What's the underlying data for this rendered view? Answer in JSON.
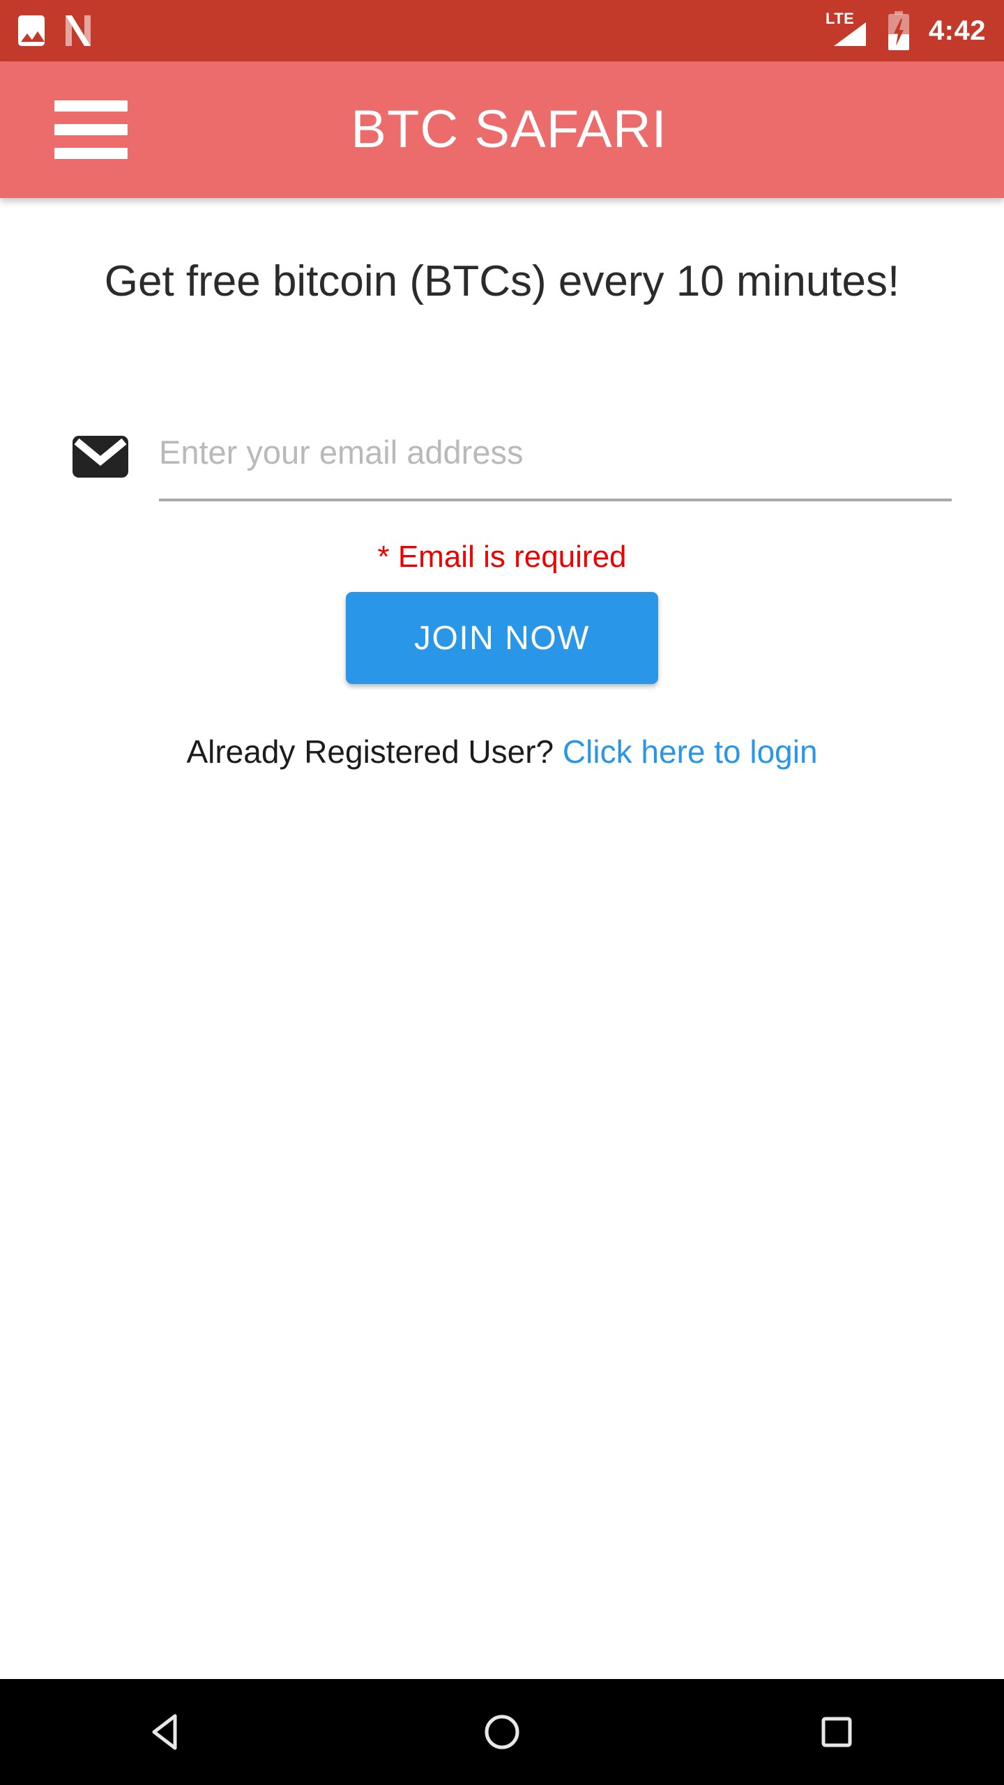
{
  "status_bar": {
    "background_color": "#C43A2A",
    "time": "4:42",
    "network_label": "LTE",
    "icons": [
      "photo-icon",
      "netflix-n-icon",
      "lte-signal-icon",
      "battery-charging-icon"
    ],
    "battery_level_percent": 40
  },
  "app_bar": {
    "background_color": "#EC6B6B",
    "title": "BTC SAFARI",
    "menu_icon": "hamburger-menu-icon"
  },
  "main": {
    "headline": "Get free bitcoin (BTCs) every 10 minutes!",
    "email": {
      "icon": "email-envelope-icon",
      "placeholder": "Enter your email address",
      "value": ""
    },
    "error_message": "* Email is required",
    "error_color": "#EE0000",
    "join_button": {
      "label": "JOIN NOW",
      "color": "#2A96E8"
    },
    "login_prompt": "Already Registered User? ",
    "login_link": "Click here to login",
    "login_link_color": "#2A96E8"
  },
  "nav_bar": {
    "background_color": "#000000",
    "buttons": [
      "back-button",
      "home-button",
      "recents-button"
    ]
  }
}
